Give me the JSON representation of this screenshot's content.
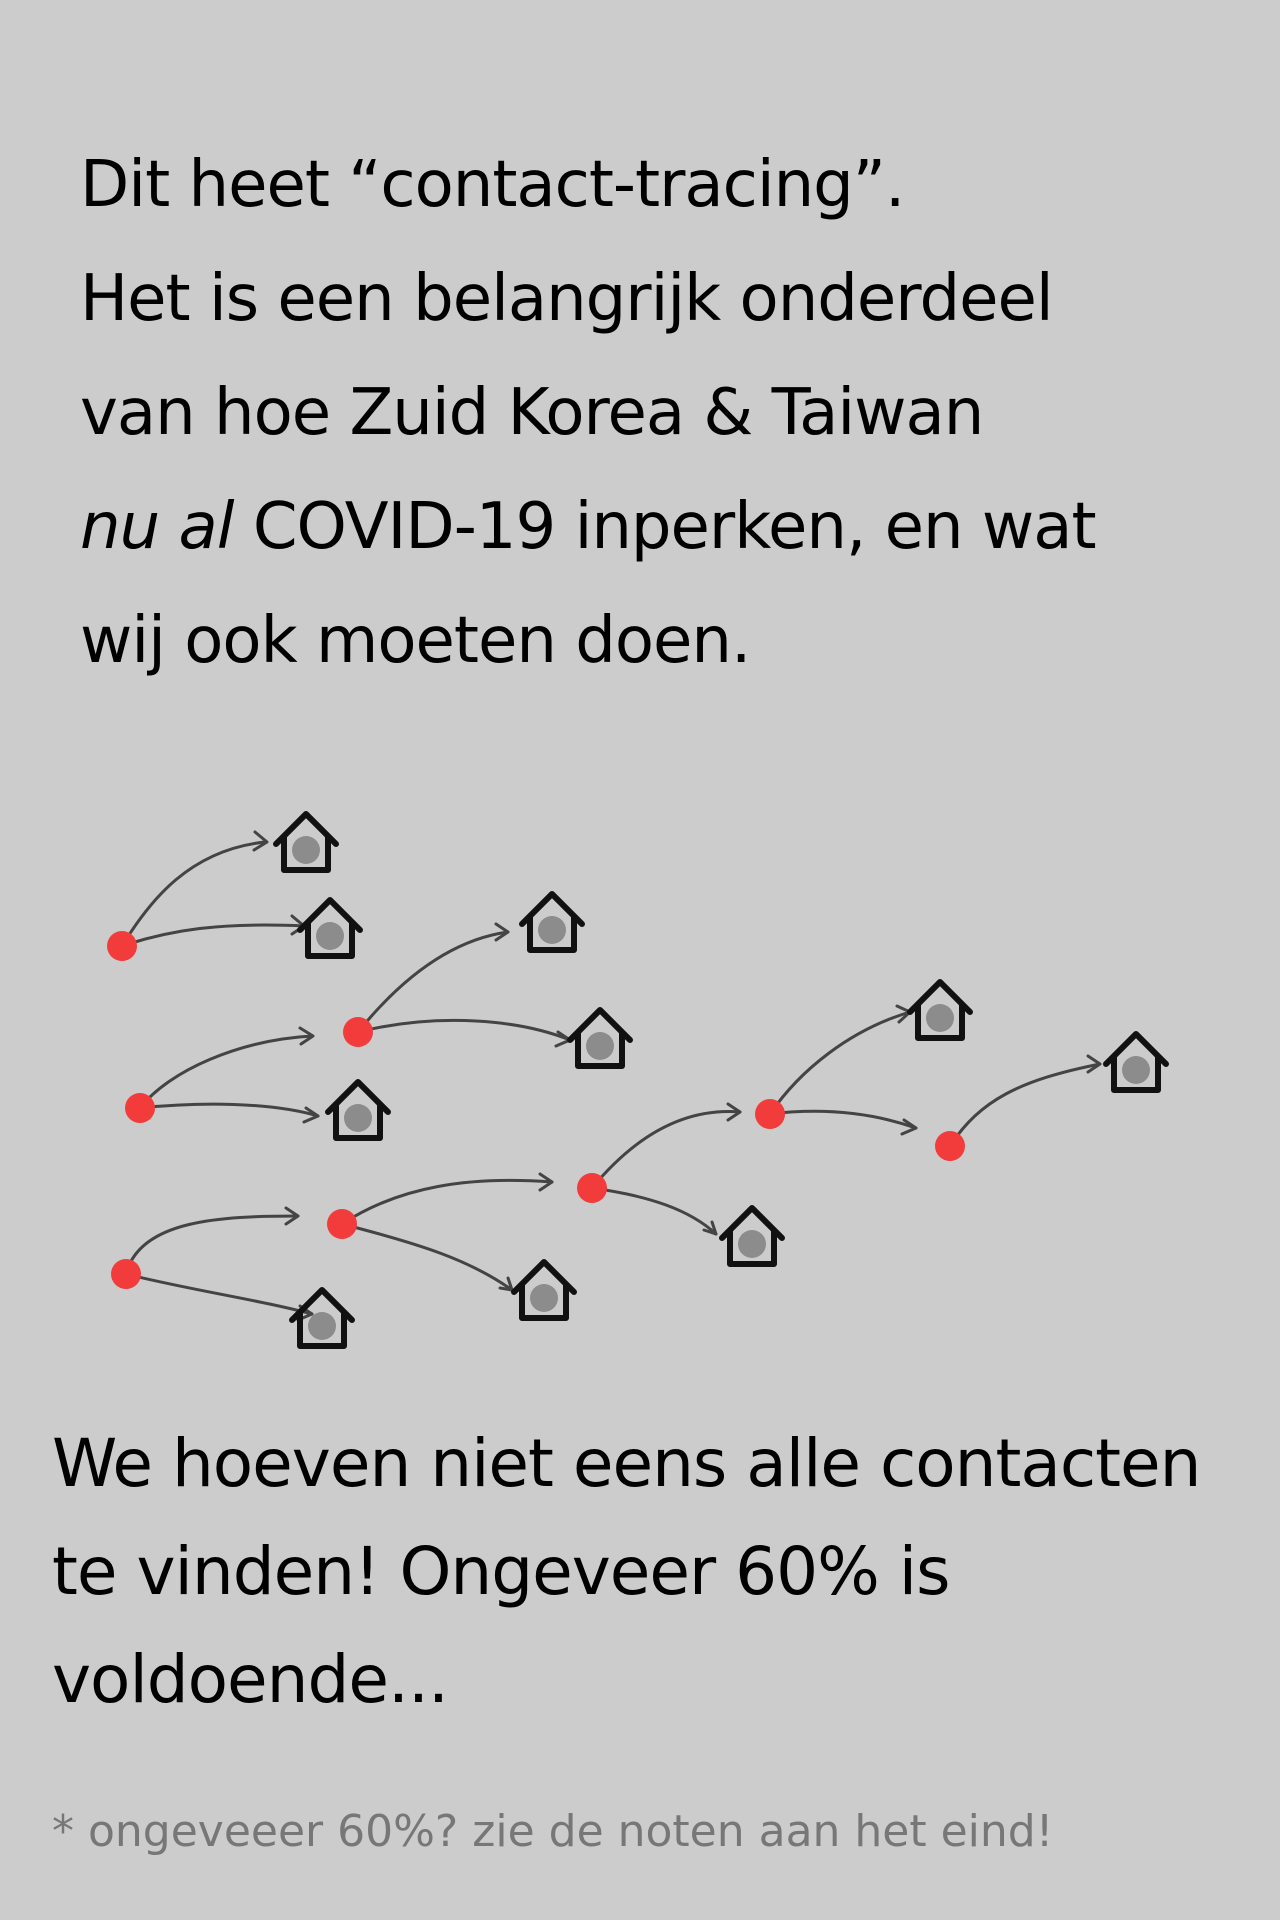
{
  "intro": {
    "line1": "Dit heet “contact-tracing”.",
    "line2": "Het is een belangrijk onderdeel",
    "line3": "van hoe Zuid Korea & Taiwan",
    "line4_italic": "nu al",
    "line4_rest": "COVID-19 inperken, en wat",
    "line5": "wij ook moeten doen."
  },
  "diagram": {
    "infected_color": "#f23c3c",
    "house_dot_color": "#8c8c8c",
    "arrow_color": "#444444",
    "house_icon": "house-icon",
    "person_icon": "infected-dot-icon"
  },
  "conclusion": {
    "line1": "We hoeven niet eens alle contacten",
    "line2": "te vinden! Ongeveer 60% is",
    "line3": "voldoende..."
  },
  "footnote": "* ongeveeer 60%? zie de noten aan het eind!"
}
